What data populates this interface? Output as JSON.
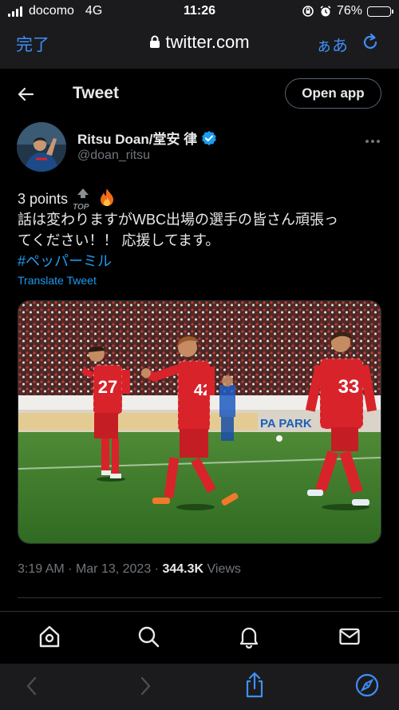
{
  "status_bar": {
    "carrier": "docomo",
    "network": "4G",
    "time": "11:26",
    "battery": "76%",
    "battery_level": 0.76
  },
  "browser": {
    "done_label": "完了",
    "url": "twitter.com",
    "text_size_label": "ぁあ"
  },
  "header": {
    "title": "Tweet",
    "open_app_label": "Open app"
  },
  "tweet": {
    "author_name": "Ritsu Doan/堂安 律",
    "author_handle": "@doan_ritsu",
    "text_line1": "3 points",
    "text_line2": "話は変わりますがWBC出場の選手の皆さん頑張っ",
    "text_line3": "てください！！ 応援してます。",
    "hashtag": "#ペッパーミル",
    "emoji_top_label": "TOP",
    "translate_label": "Translate Tweet",
    "time": "3:19 AM",
    "separator": "·",
    "date": "Mar 13, 2023",
    "views_count": "344.3K",
    "views_label": "Views"
  },
  "photo": {
    "player_left_number": "27",
    "player_center_number": "42",
    "player_right_number": "33",
    "sign_text": "PA PARK"
  },
  "colors": {
    "accent_blue": "#1d9bf0",
    "ios_blue": "#3e8ff6",
    "muted": "#71767b",
    "pitch_green": "#3f7a2a",
    "kit_red": "#d8232a"
  },
  "icons": {
    "tabbar": [
      "home-icon",
      "search-icon",
      "bell-icon",
      "mail-icon"
    ],
    "safari_toolbar": [
      "back-arrow-icon",
      "forward-arrow-icon",
      "share-icon",
      "compass-icon"
    ]
  }
}
